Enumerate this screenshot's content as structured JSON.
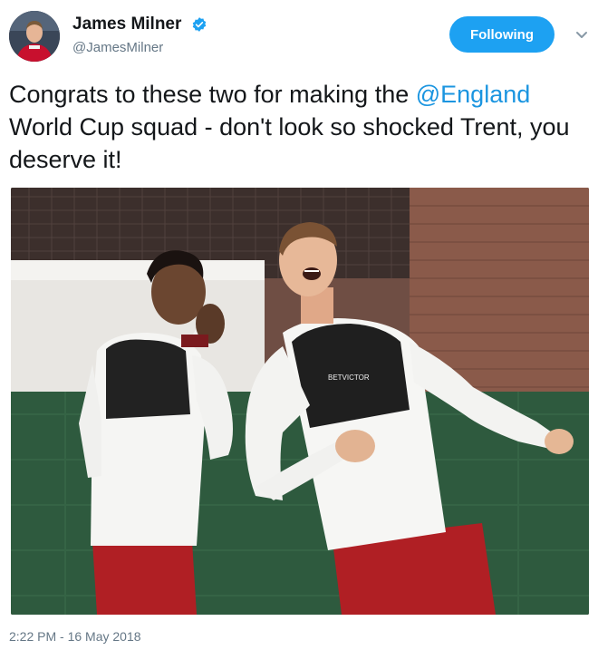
{
  "user": {
    "display_name": "James Milner",
    "handle": "@JamesMilner",
    "verified": true
  },
  "follow_button": {
    "label": "Following"
  },
  "tweet": {
    "text_before": "Congrats to these two for making the",
    "mention": "@England",
    "text_after": " World Cup squad - don't look so shocked Trent, you deserve it!",
    "timestamp": "2:22 PM - 16 May 2018"
  },
  "photo": {
    "bib_sponsor": "BETVICTOR"
  },
  "colors": {
    "accent": "#1da1f2",
    "mention": "#1b95e0",
    "muted": "#657786",
    "text": "#14171a"
  },
  "icons": {
    "verified": "verified-badge-icon",
    "menu": "chevron-down-icon"
  }
}
